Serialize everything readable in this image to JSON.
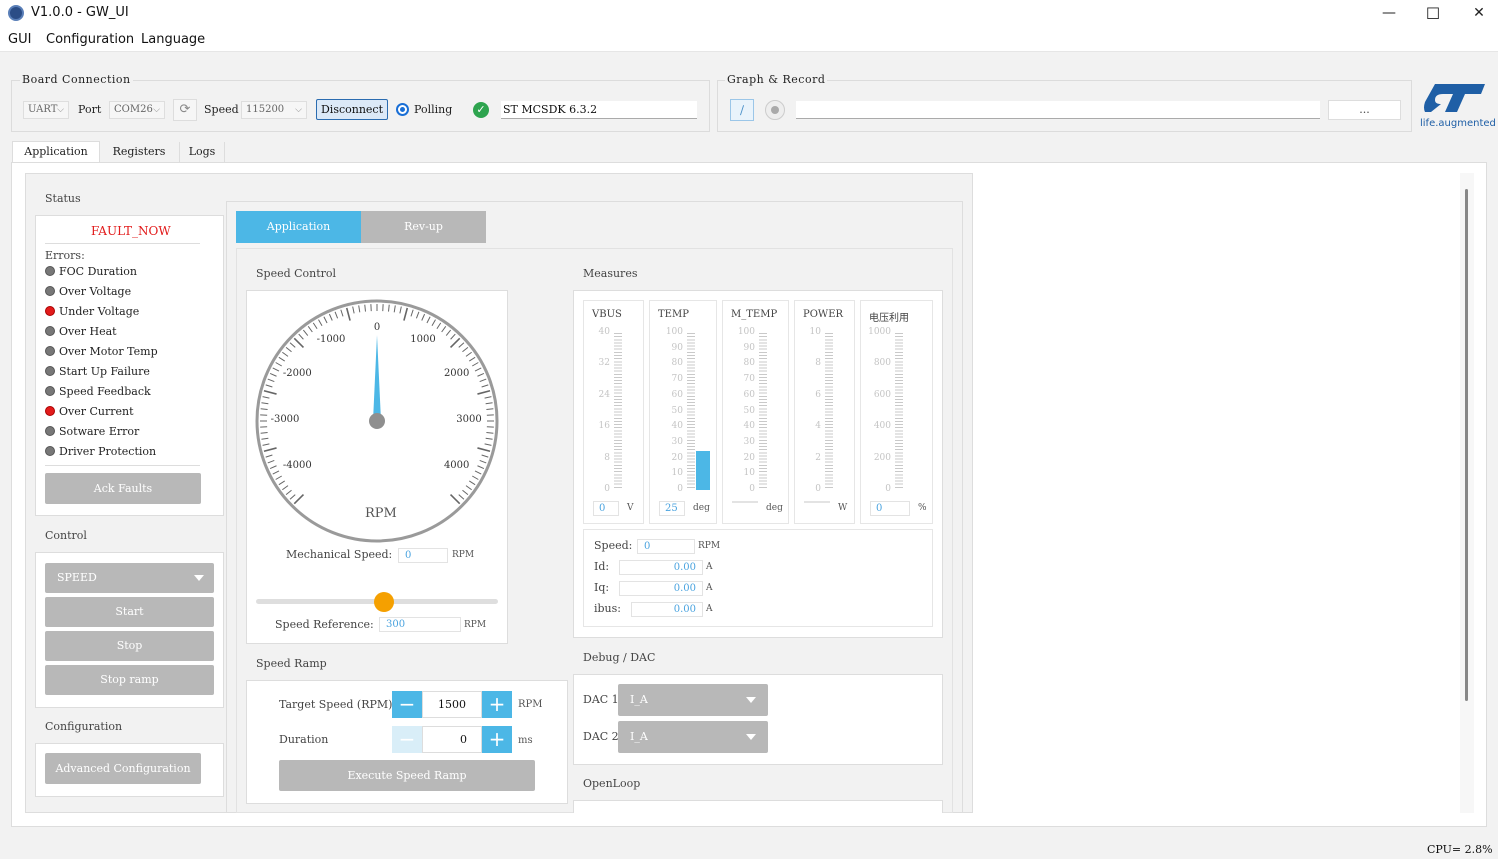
{
  "window": {
    "title": "V1.0.0 - GW_UI",
    "minimize": "—",
    "maximize": "☐",
    "close": "✕"
  },
  "menu": [
    "GUI",
    "Configuration",
    "Language"
  ],
  "board_connection": {
    "title": "Board Connection",
    "interface": "UART",
    "port_label": "Port",
    "port": "COM26",
    "speed_label": "Speed",
    "speed": "115200",
    "disconnect": "Disconnect",
    "polling": "Polling",
    "sdk": "ST MCSDK 6.3.2"
  },
  "graph_record": {
    "title": "Graph & Record",
    "path": "",
    "browse": "..."
  },
  "logo": {
    "text": "life.augmented"
  },
  "tabs": [
    "Application",
    "Registers",
    "Logs"
  ],
  "status": {
    "title": "Status",
    "fault": "FAULT_NOW",
    "errors_label": "Errors:",
    "errors": [
      {
        "name": "FOC Duration",
        "state": "grey"
      },
      {
        "name": "Over Voltage",
        "state": "grey"
      },
      {
        "name": "Under Voltage",
        "state": "red"
      },
      {
        "name": "Over Heat",
        "state": "grey"
      },
      {
        "name": "Over Motor Temp",
        "state": "grey"
      },
      {
        "name": "Start Up Failure",
        "state": "grey"
      },
      {
        "name": "Speed Feedback",
        "state": "grey"
      },
      {
        "name": "Over Current",
        "state": "red"
      },
      {
        "name": "Sotware Error",
        "state": "grey"
      },
      {
        "name": "Driver Protection",
        "state": "grey"
      }
    ],
    "ack": "Ack Faults"
  },
  "control": {
    "title": "Control",
    "mode": "SPEED",
    "start": "Start",
    "stop": "Stop",
    "stop_ramp": "Stop ramp"
  },
  "configuration": {
    "title": "Configuration",
    "advanced": "Advanced Configuration"
  },
  "subtabs": [
    "Application",
    "Rev-up"
  ],
  "speed_control": {
    "title": "Speed Control",
    "gauge_ticks": [
      "-4000",
      "-3000",
      "-2000",
      "-1000",
      "0",
      "1000",
      "2000",
      "3000",
      "4000"
    ],
    "gauge_value": 0,
    "gauge_unit": "RPM",
    "mech_speed_label": "Mechanical Speed:",
    "mech_speed": "0",
    "mech_unit": "RPM",
    "slider_fraction": 0.53,
    "ref_label": "Speed Reference:",
    "ref_value": "300",
    "ref_unit": "RPM"
  },
  "speed_ramp": {
    "title": "Speed Ramp",
    "target_label": "Target Speed (RPM)",
    "target": "1500",
    "target_unit": "RPM",
    "duration_label": "Duration",
    "duration": "0",
    "duration_unit": "ms",
    "minus": "−",
    "plus": "+",
    "execute": "Execute Speed Ramp"
  },
  "measures": {
    "title": "Measures",
    "bars": [
      {
        "name": "VBUS",
        "ticks": [
          "40",
          "32",
          "24",
          "16",
          "8",
          "0"
        ],
        "value": "0",
        "unit": "V",
        "fill": 0
      },
      {
        "name": "TEMP",
        "ticks": [
          "100",
          "90",
          "80",
          "70",
          "60",
          "50",
          "40",
          "30",
          "20",
          "10",
          "0"
        ],
        "value": "25",
        "unit": "deg",
        "fill": 0.25
      },
      {
        "name": "M_TEMP",
        "ticks": [
          "100",
          "90",
          "80",
          "70",
          "60",
          "50",
          "40",
          "30",
          "20",
          "10",
          "0"
        ],
        "value": "",
        "unit": "deg",
        "fill": 0
      },
      {
        "name": "POWER",
        "ticks": [
          "10",
          "8",
          "6",
          "4",
          "2",
          "0"
        ],
        "value": "",
        "unit": "W",
        "fill": 0
      },
      {
        "name": "电压利用",
        "ticks": [
          "1000",
          "800",
          "600",
          "400",
          "200",
          "0"
        ],
        "value": "0",
        "unit": "%",
        "fill": 0
      }
    ],
    "readouts": [
      {
        "label": "Speed:",
        "value": "0",
        "unit": "RPM"
      },
      {
        "label": "Id:",
        "value": "0.00",
        "unit": "A"
      },
      {
        "label": "Iq:",
        "value": "0.00",
        "unit": "A"
      },
      {
        "label": "ibus:",
        "value": "0.00",
        "unit": "A"
      }
    ]
  },
  "debug": {
    "title": "Debug / DAC",
    "dac1_label": "DAC 1",
    "dac1": "I_A",
    "dac2_label": "DAC 2",
    "dac2": "I_A"
  },
  "openloop": {
    "title": "OpenLoop"
  },
  "statusbar": {
    "cpu": "CPU= 2.8%"
  },
  "colors": {
    "accent": "#4cb7e6",
    "fault": "#e21b1b",
    "slider": "#f5a000",
    "button_grey": "#b8b8b8"
  }
}
